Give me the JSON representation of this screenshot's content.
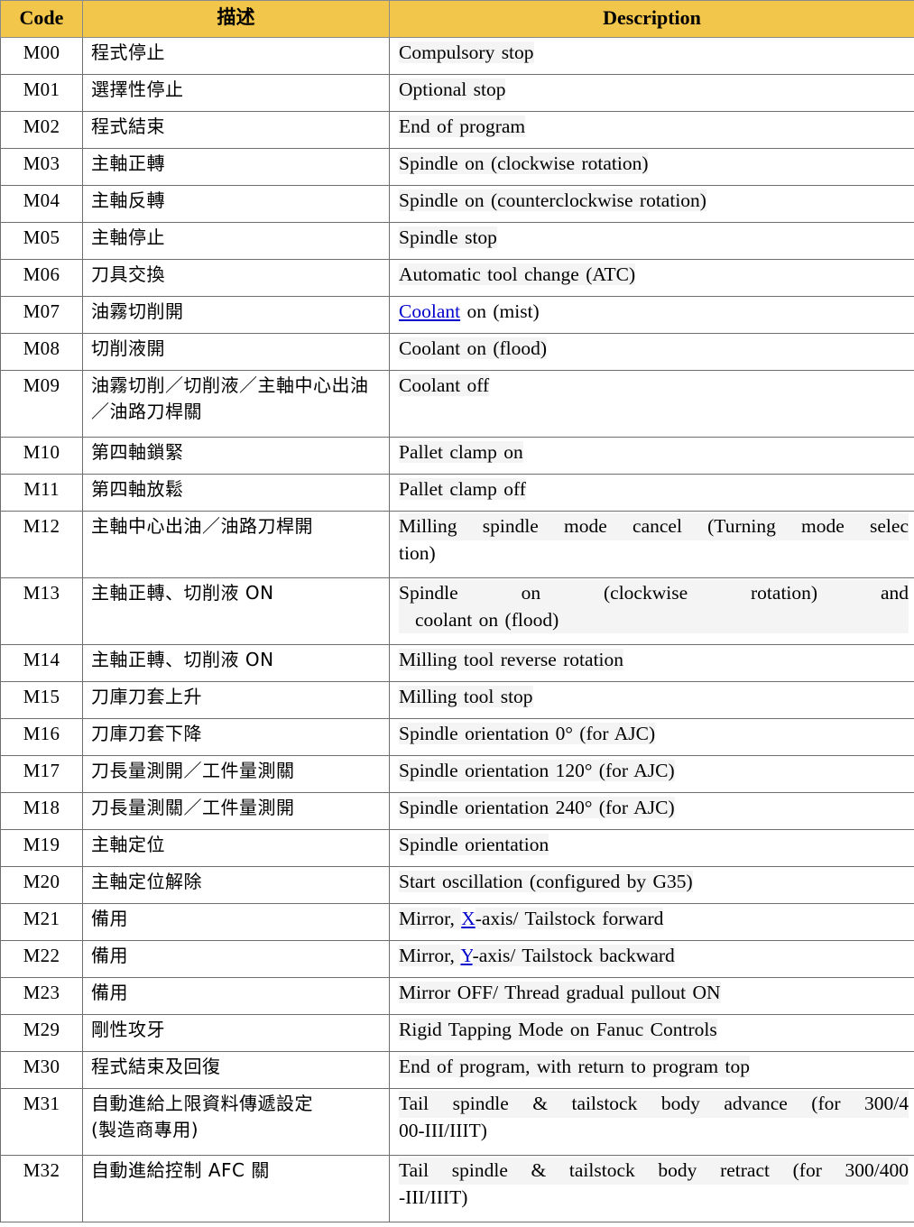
{
  "table": {
    "headers": {
      "code": "Code",
      "desc": "描述",
      "english": "Description"
    },
    "rows": [
      {
        "code": "M00",
        "desc": "程式停止",
        "english": "Compulsory stop"
      },
      {
        "code": "M01",
        "desc": "選擇性停止",
        "english": "Optional stop"
      },
      {
        "code": "M02",
        "desc": "程式結束",
        "english": "End of program"
      },
      {
        "code": "M03",
        "desc": "主軸正轉",
        "english": "Spindle on (clockwise rotation)"
      },
      {
        "code": "M04",
        "desc": "主軸反轉",
        "english": "Spindle on (counterclockwise rotation)"
      },
      {
        "code": "M05",
        "desc": "主軸停止",
        "english": "Spindle stop"
      },
      {
        "code": "M06",
        "desc": "刀具交換",
        "english": "Automatic tool change (ATC)"
      },
      {
        "code": "M07",
        "desc": "油霧切削開",
        "english": "Coolant on (mist)",
        "link_text": "Coolant",
        "english_rest": " on  (mist)"
      },
      {
        "code": "M08",
        "desc": "切削液開",
        "english": "Coolant on (flood)"
      },
      {
        "code": "M09",
        "desc": "油霧切削／切削液／主軸中心出油／油路刀桿關",
        "english": "Coolant off"
      },
      {
        "code": "M10",
        "desc": "第四軸鎖緊",
        "english": "Pallet clamp on"
      },
      {
        "code": "M11",
        "desc": "第四軸放鬆",
        "english": "Pallet clamp off"
      },
      {
        "code": "M12",
        "desc": "主軸中心出油／油路刀桿開",
        "english": "Milling spindle mode cancel (Turning mode selection)",
        "english_line1": "Milling spindle mode cancel (Turning mode selec",
        "english_line2": "tion)"
      },
      {
        "code": "M13",
        "desc": "主軸正轉、切削液 ON",
        "english": "Spindle on (clockwise rotation) and coolant on (flood)",
        "english_line1": "Spindle  on  (clockwise  rotation)  and",
        "english_line2": "coolant  on  (flood)"
      },
      {
        "code": "M14",
        "desc": "主軸正轉、切削液 ON",
        "english": "Milling tool reverse rotation"
      },
      {
        "code": "M15",
        "desc": "刀庫刀套上升",
        "english": "Milling tool stop"
      },
      {
        "code": "M16",
        "desc": "刀庫刀套下降",
        "english": "Spindle orientation 0° (for AJC)"
      },
      {
        "code": "M17",
        "desc": "刀長量測開／工件量測關",
        "english": "Spindle orientation 120° (for AJC)"
      },
      {
        "code": "M18",
        "desc": "刀長量測關／工件量測開",
        "english": "Spindle orientation 240° (for AJC)"
      },
      {
        "code": "M19",
        "desc": "主軸定位",
        "english": "Spindle orientation"
      },
      {
        "code": "M20",
        "desc": "主軸定位解除",
        "english": "Start oscillation (configured by G35)"
      },
      {
        "code": "M21",
        "desc": "備用",
        "english": "Mirror, X-axis/ Tailstock forward",
        "english_pre": "Mirror, ",
        "link_text": "X",
        "english_rest": "-axis/  Tailstock  forward"
      },
      {
        "code": "M22",
        "desc": "備用",
        "english": "Mirror, Y-axis/ Tailstock backward",
        "english_pre": "Mirror, ",
        "link_text": "Y",
        "english_rest": "-axis/  Tailstock  backward"
      },
      {
        "code": "M23",
        "desc": "備用",
        "english": "Mirror OFF/ Thread gradual pullout ON"
      },
      {
        "code": "M29",
        "desc": "剛性攻牙",
        "english": "Rigid Tapping Mode on Fanuc Controls"
      },
      {
        "code": "M30",
        "desc": "程式結束及回復",
        "english": "End of program, with return to program top"
      },
      {
        "code": "M31",
        "desc": "自動進給上限資料傳遞設定(製造商專用)",
        "desc_line1": "自動進給上限資料傳遞設定",
        "desc_line2": "(製造商專用)",
        "english": "Tail spindle & tailstock body advance (for 300/400-III/IIIT)",
        "english_line1": "Tail spindle & tailstock body advance (for 300/4",
        "english_line2": "00-III/IIIT)"
      },
      {
        "code": "M32",
        "desc": "自動進給控制 AFC 關",
        "english": "Tail spindle & tailstock body retract (for 300/400 -III/IIIT)",
        "english_line1": "Tail spindle & tailstock body retract (for 300/400",
        "english_line2": "-III/IIIT)"
      }
    ]
  },
  "colors": {
    "header_background": "#f2c64a",
    "link": "#0000cc",
    "border": "#6f6f6f",
    "highlight": "#f4f4f4"
  }
}
